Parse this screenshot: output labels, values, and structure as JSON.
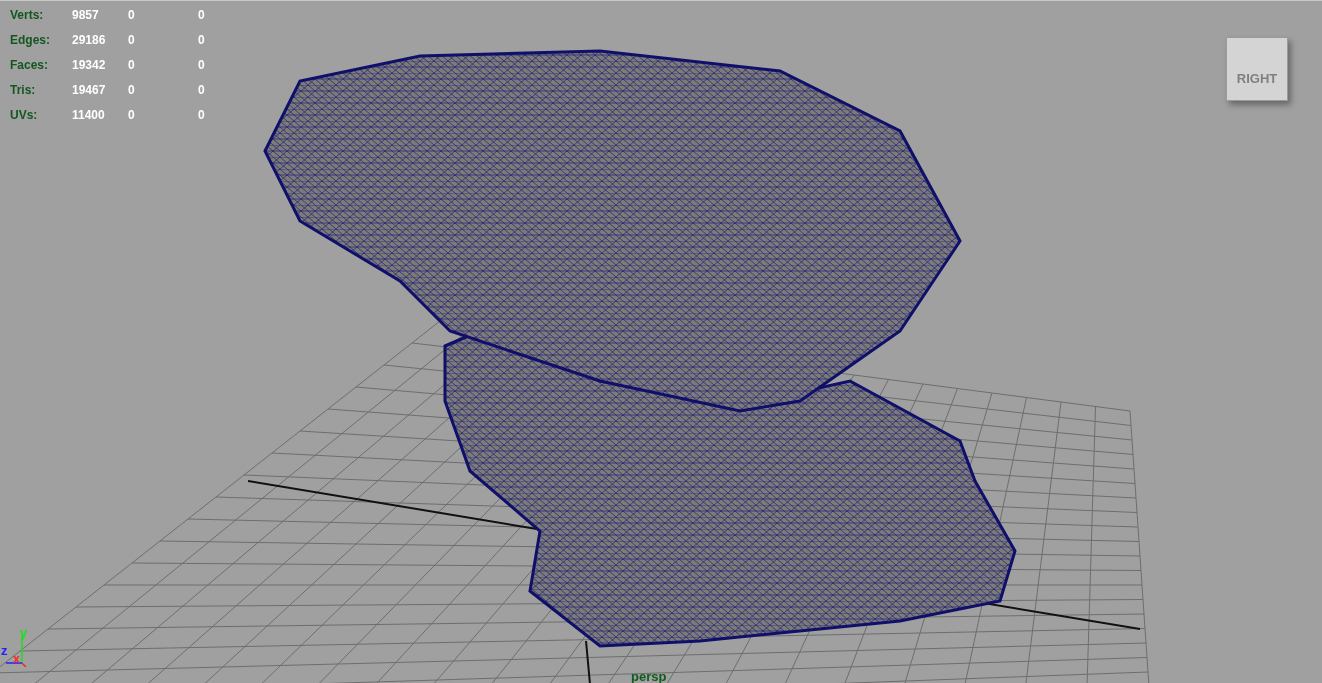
{
  "hud": [
    {
      "label": "Verts:",
      "values": [
        "9857",
        "0",
        "0"
      ]
    },
    {
      "label": "Edges:",
      "values": [
        "29186",
        "0",
        "0"
      ]
    },
    {
      "label": "Faces:",
      "values": [
        "19342",
        "0",
        "0"
      ]
    },
    {
      "label": "Tris:",
      "values": [
        "19467",
        "0",
        "0"
      ]
    },
    {
      "label": "UVs:",
      "values": [
        "11400",
        "0",
        "0"
      ]
    }
  ],
  "view_cube": {
    "label": "RIGHT"
  },
  "axis": {
    "y": "y",
    "z": "z",
    "x": "x"
  },
  "camera_label": "persp"
}
